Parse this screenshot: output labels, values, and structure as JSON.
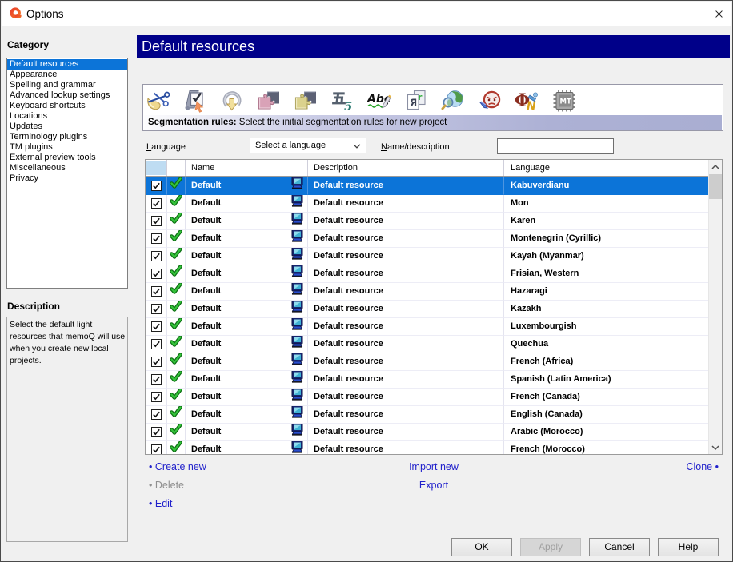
{
  "window": {
    "title": "Options",
    "close_icon": "close-icon"
  },
  "colors": {
    "header_navy": "#000089",
    "selection_blue": "#0c74d8",
    "link_blue": "#2121cb",
    "segbar_lavender": "#a9aed2",
    "select_all_cell": "#bedcf2",
    "logo_red": "#e8392c",
    "logo_orange": "#f58220"
  },
  "sidebar": {
    "category_label": "Category",
    "items": [
      {
        "label": "Default resources",
        "selected": true
      },
      {
        "label": "Appearance",
        "selected": false
      },
      {
        "label": "Spelling and grammar",
        "selected": false
      },
      {
        "label": "Advanced lookup settings",
        "selected": false
      },
      {
        "label": "Keyboard shortcuts",
        "selected": false
      },
      {
        "label": "Locations",
        "selected": false
      },
      {
        "label": "Updates",
        "selected": false
      },
      {
        "label": "Terminology plugins",
        "selected": false
      },
      {
        "label": "TM plugins",
        "selected": false
      },
      {
        "label": "External preview tools",
        "selected": false
      },
      {
        "label": "Miscellaneous",
        "selected": false
      },
      {
        "label": "Privacy",
        "selected": false
      }
    ],
    "description_label": "Description",
    "description_text": "Select the default light resources that memoQ will use when you create new local projects."
  },
  "header": {
    "title": "Default resources"
  },
  "toolbar": {
    "icons": [
      "scissors-segmentation-icon",
      "checked-document-icon",
      "circular-arrow-icon",
      "pink-puzzle-icon",
      "yellow-puzzle-icon",
      "number-five-icon",
      "abc-spellcheck-icon",
      "document-r-icon",
      "globe-search-icon",
      "face-pen-icon",
      "phi-font-icon",
      "mt-chip-icon"
    ],
    "info_label": "Segmentation rules:",
    "info_text": "Select the initial segmentation rules for new project"
  },
  "filters": {
    "language_label": {
      "key": "L",
      "post": "anguage"
    },
    "language_value": "Select a language",
    "name_label": {
      "key": "N",
      "post": "ame/description"
    },
    "name_value": ""
  },
  "table": {
    "columns": {
      "name": "Name",
      "description": "Description",
      "language": "Language"
    },
    "rows": [
      {
        "checked": true,
        "name": "Default",
        "description": "Default resource",
        "language": "Kabuverdianu",
        "selected": true
      },
      {
        "checked": true,
        "name": "Default",
        "description": "Default resource",
        "language": "Mon",
        "selected": false
      },
      {
        "checked": true,
        "name": "Default",
        "description": "Default resource",
        "language": "Karen",
        "selected": false
      },
      {
        "checked": true,
        "name": "Default",
        "description": "Default resource",
        "language": "Montenegrin (Cyrillic)",
        "selected": false
      },
      {
        "checked": true,
        "name": "Default",
        "description": "Default resource",
        "language": "Kayah (Myanmar)",
        "selected": false
      },
      {
        "checked": true,
        "name": "Default",
        "description": "Default resource",
        "language": "Frisian, Western",
        "selected": false
      },
      {
        "checked": true,
        "name": "Default",
        "description": "Default resource",
        "language": "Hazaragi",
        "selected": false
      },
      {
        "checked": true,
        "name": "Default",
        "description": "Default resource",
        "language": "Kazakh",
        "selected": false
      },
      {
        "checked": true,
        "name": "Default",
        "description": "Default resource",
        "language": "Luxembourgish",
        "selected": false
      },
      {
        "checked": true,
        "name": "Default",
        "description": "Default resource",
        "language": "Quechua",
        "selected": false
      },
      {
        "checked": true,
        "name": "Default",
        "description": "Default resource",
        "language": "French (Africa)",
        "selected": false
      },
      {
        "checked": true,
        "name": "Default",
        "description": "Default resource",
        "language": "Spanish (Latin America)",
        "selected": false
      },
      {
        "checked": true,
        "name": "Default",
        "description": "Default resource",
        "language": "French (Canada)",
        "selected": false
      },
      {
        "checked": true,
        "name": "Default",
        "description": "Default resource",
        "language": "English (Canada)",
        "selected": false
      },
      {
        "checked": true,
        "name": "Default",
        "description": "Default resource",
        "language": "Arabic (Morocco)",
        "selected": false
      },
      {
        "checked": true,
        "name": "Default",
        "description": "Default resource",
        "language": "French (Morocco)",
        "selected": false
      }
    ]
  },
  "links": {
    "bullet": "•",
    "create_new": "Create new",
    "import_new": "Import new",
    "clone": "Clone",
    "delete": "Delete",
    "export": "Export",
    "edit": "Edit"
  },
  "buttons": {
    "ok": {
      "pre": "",
      "key": "O",
      "post": "K"
    },
    "apply": {
      "pre": "",
      "key": "A",
      "post": "pply"
    },
    "cancel": {
      "pre": "Ca",
      "key": "n",
      "post": "cel"
    },
    "help": {
      "pre": "",
      "key": "H",
      "post": "elp"
    }
  }
}
